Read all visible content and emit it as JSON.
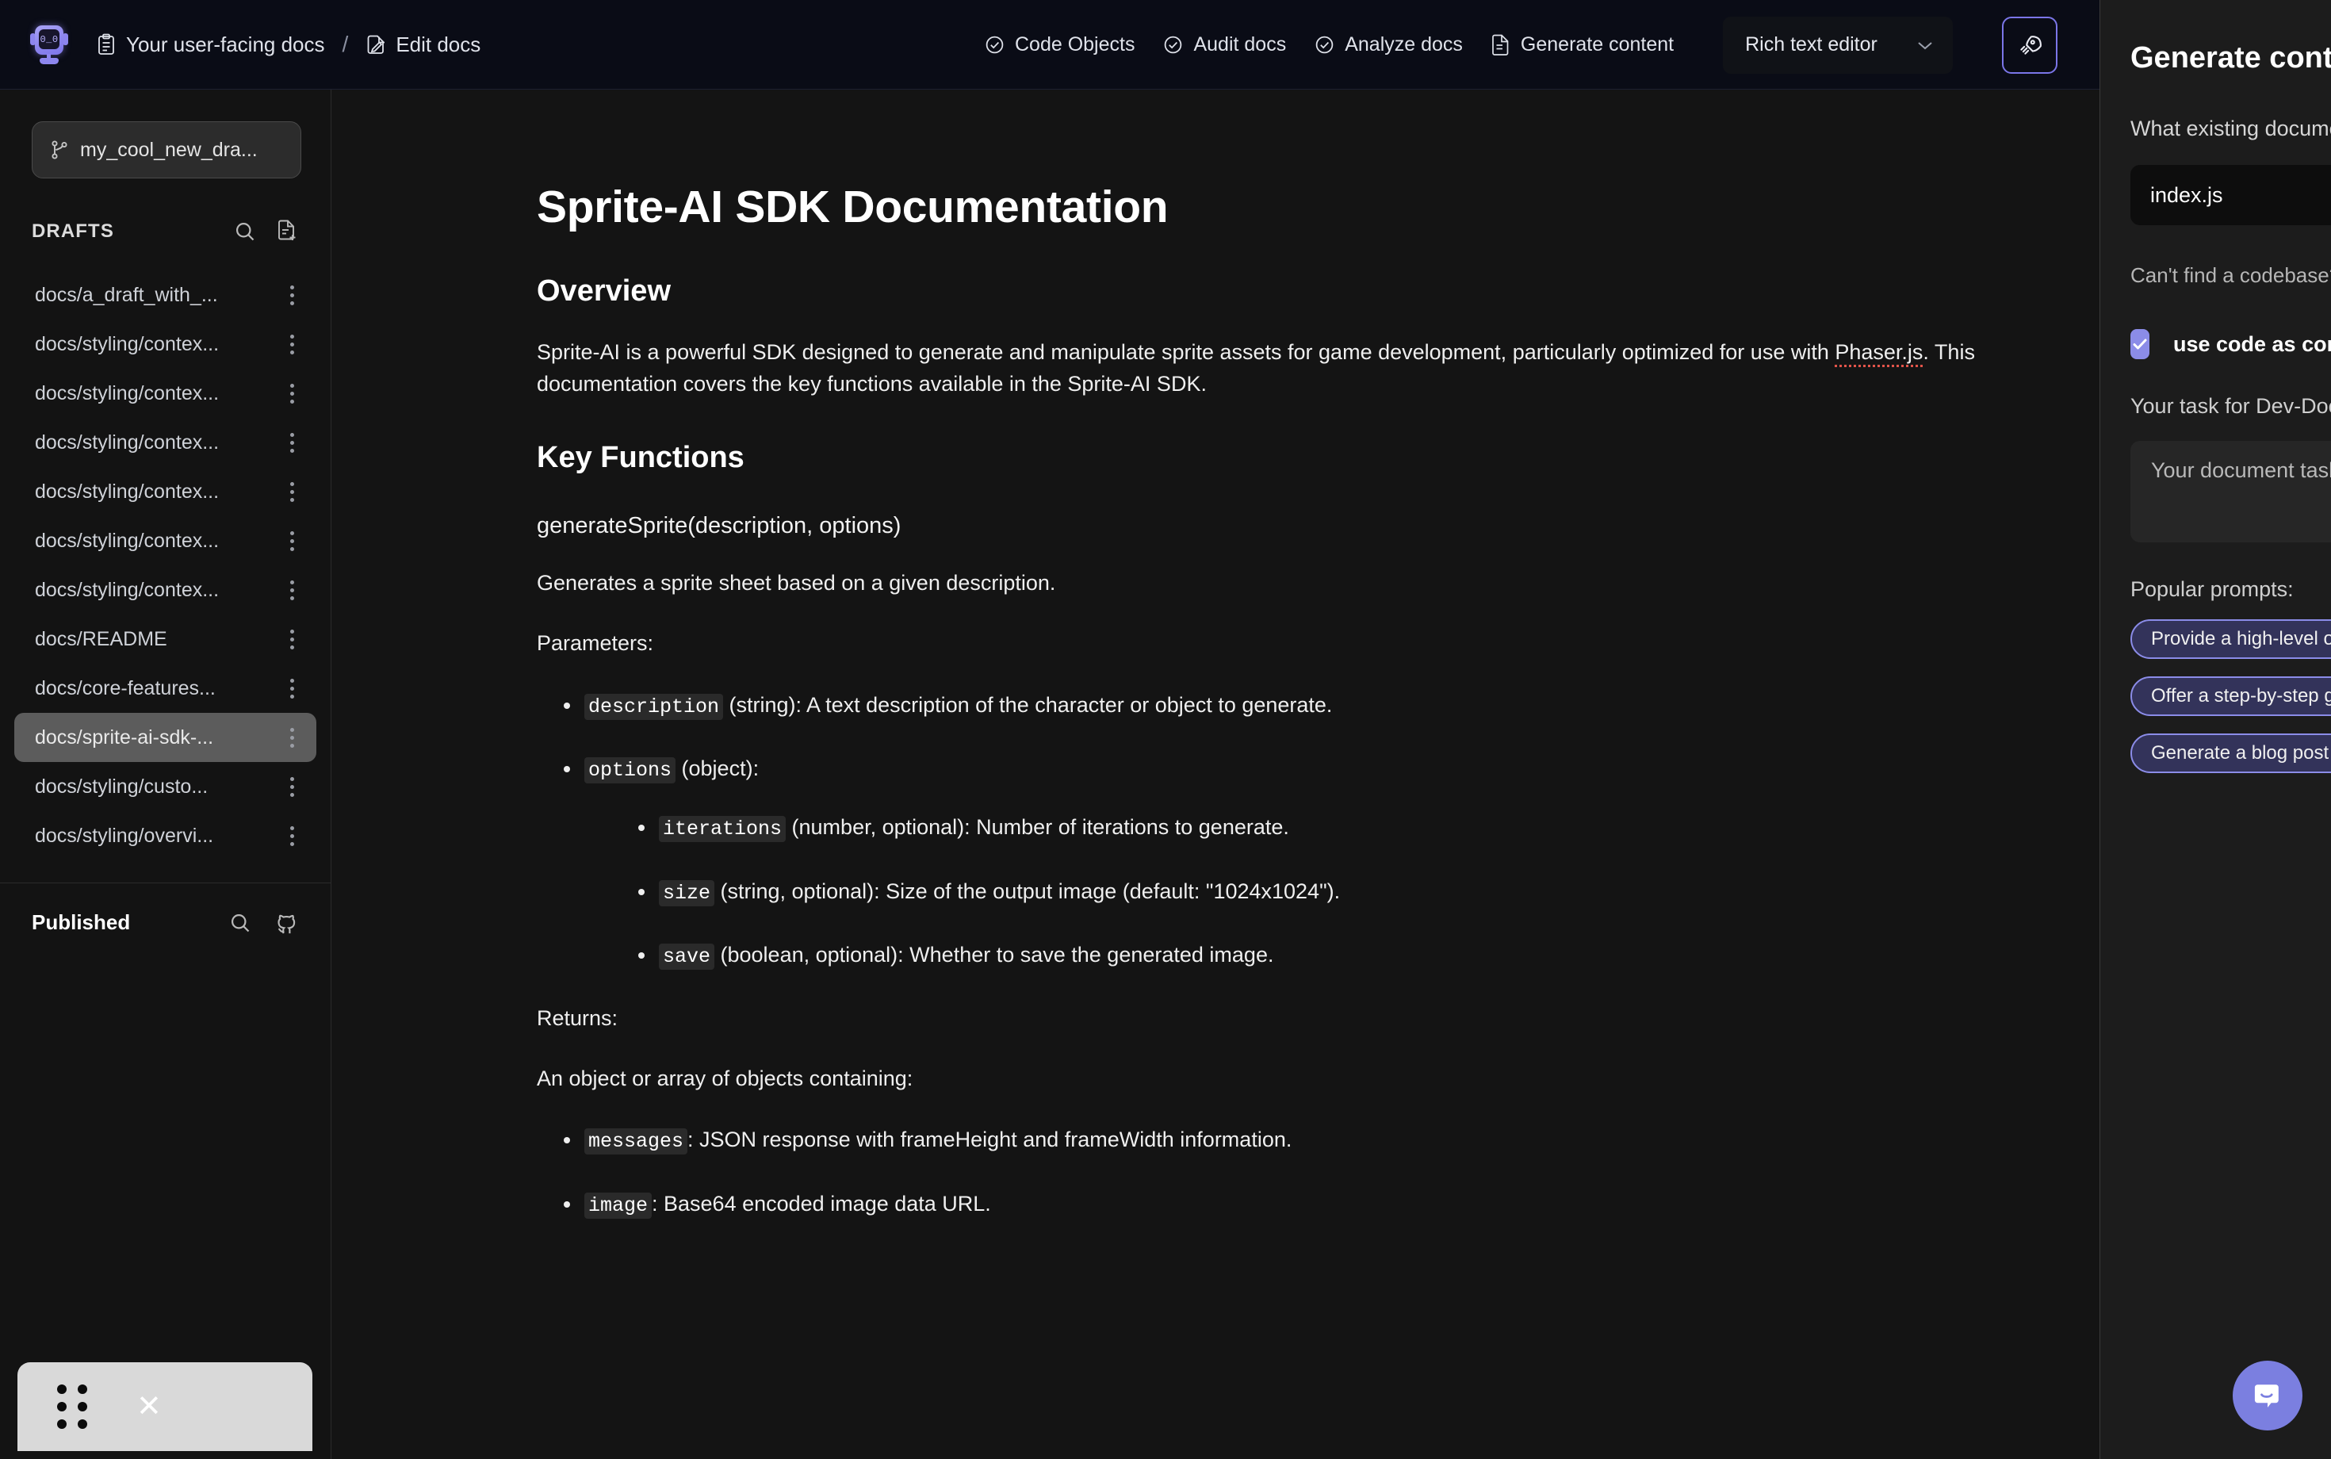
{
  "topbar": {
    "logo_name": "sprite-ai-robot-logo",
    "logo_face": "0_0",
    "breadcrumb": [
      {
        "label": "Your user-facing docs",
        "icon": "clipboard-icon"
      },
      {
        "label": "Edit docs",
        "icon": "edit-document-icon"
      }
    ],
    "separator": "/",
    "nav_items": [
      {
        "label": "Code Objects",
        "icon": "check-circle-icon"
      },
      {
        "label": "Audit docs",
        "icon": "check-circle-icon"
      },
      {
        "label": "Analyze docs",
        "icon": "check-circle-icon"
      },
      {
        "label": "Generate content",
        "icon": "document-icon"
      }
    ],
    "editor_select": {
      "value": "Rich text editor",
      "icon": "chevron-down-icon"
    },
    "rocket_button": {
      "icon": "rocket-icon",
      "accent": "#7b76e8"
    }
  },
  "sidebar": {
    "branch": {
      "label": "my_cool_new_dra...",
      "icon": "git-branch-icon"
    },
    "drafts": {
      "title": "DRAFTS",
      "search_icon": "search-icon",
      "new_doc_icon": "new-document-icon",
      "items": [
        {
          "label": "docs/a_draft_with_...",
          "selected": false
        },
        {
          "label": "docs/styling/contex...",
          "selected": false
        },
        {
          "label": "docs/styling/contex...",
          "selected": false
        },
        {
          "label": "docs/styling/contex...",
          "selected": false
        },
        {
          "label": "docs/styling/contex...",
          "selected": false
        },
        {
          "label": "docs/styling/contex...",
          "selected": false
        },
        {
          "label": "docs/styling/contex...",
          "selected": false
        },
        {
          "label": "docs/README",
          "selected": false
        },
        {
          "label": "docs/core-features...",
          "selected": false
        },
        {
          "label": "docs/sprite-ai-sdk-...",
          "selected": true
        },
        {
          "label": "docs/styling/custo...",
          "selected": false
        },
        {
          "label": "docs/styling/overvi...",
          "selected": false
        }
      ]
    },
    "published": {
      "title": "Published",
      "search_icon": "search-icon",
      "github_icon": "github-icon"
    },
    "dock": {
      "drag_icon": "drag-handle-icon",
      "close_icon": "close-icon"
    }
  },
  "document": {
    "title": "Sprite-AI SDK Documentation",
    "overview_heading": "Overview",
    "overview_p1_a": "Sprite-AI is a powerful SDK designed to generate and manipulate sprite assets for game development, particularly optimized for use with ",
    "overview_p1_misspelled": "Phaser.js",
    "overview_p1_b": ". This documentation covers the key functions available in the Sprite-AI SDK.",
    "key_functions_heading": "Key Functions",
    "function_signature": "generateSprite(description, options)",
    "function_desc": "Generates a sprite sheet based on a given description.",
    "parameters_label": "Parameters:",
    "params": [
      {
        "code": "description",
        "text": " (string): A text description of the character or object to generate."
      },
      {
        "code": "options",
        "text": " (object):"
      }
    ],
    "sub_params": [
      {
        "code": "iterations",
        "text": " (number, optional): Number of iterations to generate."
      },
      {
        "code": "size",
        "text": " (string, optional): Size of the output image (default: \"1024x1024\")."
      },
      {
        "code": "save",
        "text": " (boolean, optional): Whether to save the generated image."
      }
    ],
    "returns_label": "Returns:",
    "returns_desc": "An object or array of objects containing:",
    "returns": [
      {
        "code": "messages",
        "text": ": JSON response with frameHeight and frameWidth information."
      },
      {
        "code": "image",
        "text": ": Base64 encoded image data URL."
      }
    ]
  },
  "panel": {
    "title": "Generate content",
    "codebase_label": "What existing documentation do you want to use?",
    "codebase_value": "index.js",
    "cant_find_hint": "Can't find a codebase?",
    "use_code_checkbox": {
      "label": "use code as context",
      "checked": true,
      "color": "#8b8ce8"
    },
    "task_label": "Your task for Dev-Docs",
    "task_placeholder": "Your document task",
    "popular_prompts_label": "Popular prompts:",
    "prompts": [
      "Provide a high-level overview",
      "Offer a step-by-step guide",
      "Generate a blog post"
    ]
  },
  "launcher": {
    "icon": "chat-bubble-icon",
    "color": "#7b7fe0"
  }
}
